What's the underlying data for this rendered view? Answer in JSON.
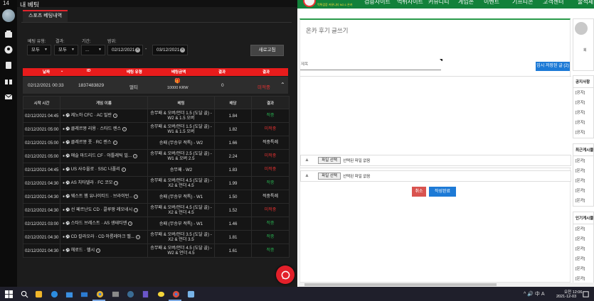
{
  "left_window": {
    "title": "내 베팅",
    "tab": "스포츠 베팅내역",
    "filters": {
      "labels": [
        "베팅 유형:",
        "결과:",
        "기간:",
        "범위:"
      ],
      "type_value": "모두",
      "result_value": "모두",
      "period_value": "...",
      "range_from": "02/12/2021",
      "range_to": "03/12/2021",
      "range_separator": "-",
      "refresh_label": "새로고침"
    },
    "bet_header": [
      "날짜",
      "ID",
      "베팅 유형",
      "베팅금액",
      "결과",
      "결과"
    ],
    "bet_row": {
      "date": "02/12/2021 00:33",
      "id": "1837483829",
      "type": "멀티",
      "amount": "10000 KRW",
      "result": "0",
      "status": "미적중"
    },
    "sub_table": {
      "headers": [
        "시작 시간",
        "게임 이름",
        "베팅",
        "배당",
        "결과"
      ],
      "rows": [
        {
          "time": "02/12/2021 04:45",
          "game": "제노아 CFC · AC 밀란",
          "bet": "승무패 & 오버/언더 1.5 (도달 골) - W2 & 1.5 오버",
          "odds": "1.84",
          "result": "적중"
        },
        {
          "time": "02/12/2021 05:00",
          "game": "클레르몽 리용 · 스타드 렌스",
          "bet": "승무패 & 오버/언더 1.5 (도달 골) - W1 & 1.5 오버",
          "odds": "1.82",
          "result": "미적중"
        },
        {
          "time": "02/12/2021 05:00",
          "game": "클레르몽 풋 · RC 렌스",
          "bet": "승패 (무승부 적특) - W2",
          "odds": "1.66",
          "result": "적중특례"
        },
        {
          "time": "02/12/2021 05:00",
          "game": "애슬 마드리드 CF · 아틀레틱 빌...",
          "bet": "승무패 & 오버/언더 2.5 (도달 골) - W1 & 오버 2.5",
          "odds": "2.24",
          "result": "미적중"
        },
        {
          "time": "02/12/2021 04:45",
          "game": "US 사수올로 · SSC 나폴리",
          "bet": "승무패 - W2",
          "odds": "1.83",
          "result": "미적중"
        },
        {
          "time": "02/12/2021 04:30",
          "game": "AS 치타델라 · FC 코모",
          "bet": "승무패 & 오버/언더 4.5 (도달 골) - X2 & 언더 4.5",
          "odds": "1.99",
          "result": "적중"
        },
        {
          "time": "02/12/2021 04:30",
          "game": "웨스트 햄 유나이티드 · 브라이턴...",
          "bet": "승패 (무승부 적특) - W1",
          "odds": "1.50",
          "result": "적중특례"
        },
        {
          "time": "02/12/2021 04:30",
          "game": "선 페르난도 CD · 콜루팡 레오네시",
          "bet": "승무패 & 오버/언더 4.5 (도달 골) - X2 & 언더 4.5",
          "odds": "1.52",
          "result": "미적중"
        },
        {
          "time": "02/12/2021 03:00",
          "game": "스타드 브레스트 · AS 생테티엔",
          "bet": "승패 (무승부 적특) - W1",
          "odds": "1.46",
          "result": "적중"
        },
        {
          "time": "02/12/2021 04:30",
          "game": "CD 칼라오라 · CD 아름레아크 벨...",
          "bet": "승무패 & 오버/언더 3.5 (도달 골) - X2 & 언더 3.5",
          "odds": "1.81",
          "result": "적중"
        },
        {
          "time": "02/12/2021 04:30",
          "game": "헤로드 · 헬시",
          "bet": "승무패 & 오버/언더 4.5 (도달 골) - W2 & 언더 4.5",
          "odds": "1.61",
          "result": "적중"
        }
      ]
    }
  },
  "right_window": {
    "nav": [
      "검증사이트",
      "먹튀사이트",
      "커뮤니티",
      "게임존",
      "이벤트",
      "기프티콘",
      "고객센터",
      "출석체"
    ],
    "logo_sub": "먹튀검증 커뮤니티 NO.1 온카",
    "write_title": "온카 후기 글쓰기",
    "subject_placeholder": "제목",
    "temp_save_label": "임시 저장된 글 (2)",
    "file_button": "파일 선택",
    "file_none": "선택된 파일 없음",
    "cancel_label": "취소",
    "submit_label": "작성완료",
    "side": {
      "profile_label": "회",
      "notice_title": "공지사항",
      "recent_title": "최근게시물",
      "popular_title": "인기게시물",
      "notice_items": [
        "[공지]",
        "[공지]",
        "[공지]",
        "[공지]",
        "[공지]"
      ],
      "recent_items": [
        "[온카]",
        "[온카]",
        "[온카]",
        "[온카]",
        "[온카]"
      ],
      "popular_items": [
        "[온카]",
        "[온카]",
        "[온카]",
        "[온카]",
        "[온카]",
        "[온카]"
      ]
    }
  },
  "taskbar": {
    "tray": "^ 🔊 中 A",
    "time": "오전 12:06",
    "date": "2021-12-03"
  },
  "colors": {
    "accent_red": "#e81c1c",
    "win_green": "#28b050",
    "lose_red": "#e83232",
    "site_green": "#12813a",
    "btn_blue": "#1d7ad6"
  }
}
